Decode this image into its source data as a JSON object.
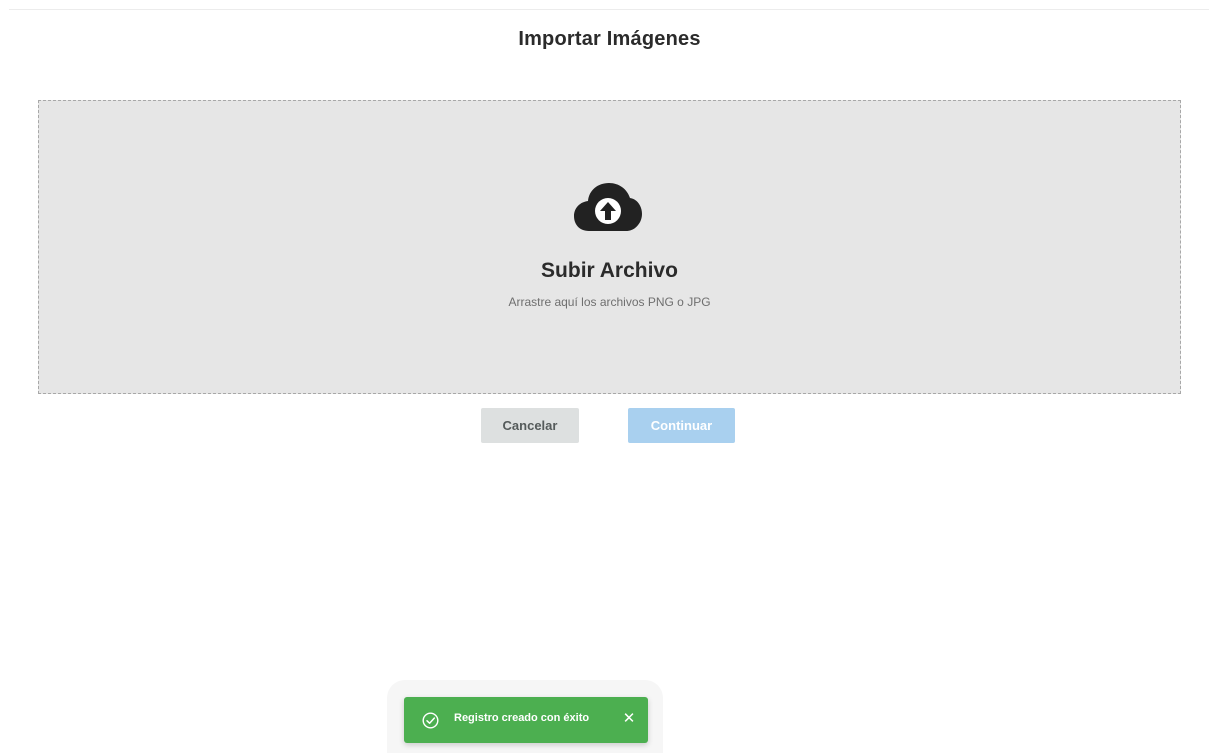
{
  "header": {
    "title": "Importar Imágenes"
  },
  "dropzone": {
    "icon": "cloud-upload-icon",
    "title": "Subir Archivo",
    "hint": "Arrastre aquí los archivos PNG o JPG"
  },
  "actions": {
    "cancel_label": "Cancelar",
    "continue_label": "Continuar"
  },
  "toast": {
    "icon": "check-circle-icon",
    "message": "Registro creado con éxito",
    "close_icon": "close-icon",
    "close_glyph": "✕",
    "color": "#4caf50"
  },
  "colors": {
    "dropzone_bg": "#e6e6e6",
    "cancel_bg": "#dde0e0",
    "continue_bg": "#a9d0ef",
    "toast_bg": "#4caf50"
  }
}
